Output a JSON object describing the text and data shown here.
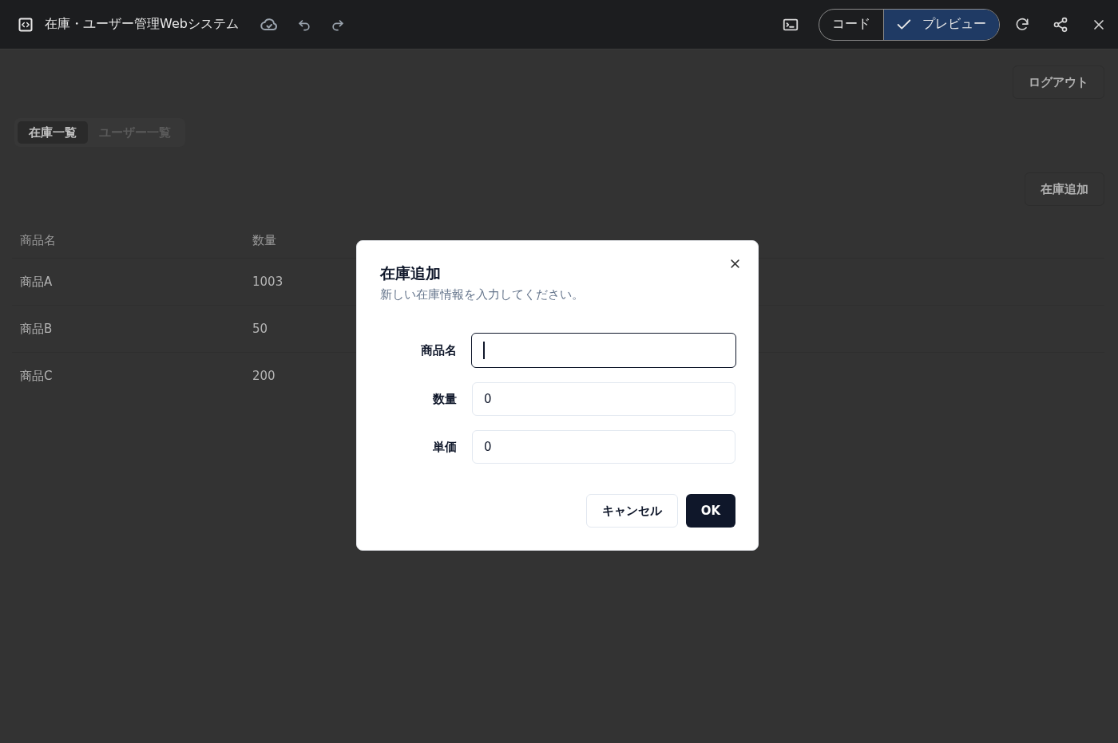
{
  "app_bar": {
    "title": "在庫・ユーザー管理Webシステム",
    "view_toggle": [
      {
        "label": "コード",
        "selected": false
      },
      {
        "label": "プレビュー",
        "selected": true
      }
    ]
  },
  "page": {
    "logout_button": "ログアウト",
    "tabs": [
      {
        "label": "在庫一覧",
        "selected": true
      },
      {
        "label": "ユーザー一覧",
        "selected": false
      }
    ],
    "add_button": "在庫追加",
    "table": {
      "columns": [
        "商品名",
        "数量"
      ],
      "rows": [
        [
          "商品A",
          "1003"
        ],
        [
          "商品B",
          "50"
        ],
        [
          "商品C",
          "200"
        ]
      ]
    }
  },
  "dialog": {
    "title": "在庫追加",
    "description": "新しい在庫情報を入力してください。",
    "fields": [
      {
        "label": "商品名",
        "focused": true
      },
      {
        "label": "数量",
        "value": "0",
        "focused": false
      },
      {
        "label": "単価",
        "value": "0",
        "focused": false
      }
    ],
    "buttons": [
      {
        "label": "キャンセル",
        "kind": "secondary"
      },
      {
        "label": "OK",
        "kind": "primary"
      }
    ]
  }
}
